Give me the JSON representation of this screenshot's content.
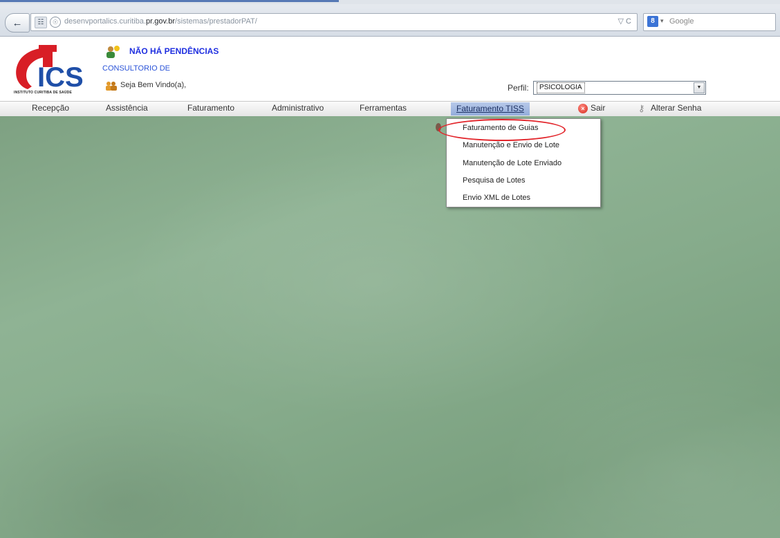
{
  "browser": {
    "url_prefix": "desenvportalics.curitiba.",
    "url_domain": "pr.gov.br",
    "url_suffix": "/sistemas/prestadorPAT/",
    "url_controls": "▽ C",
    "search_engine": "Google",
    "search_caret": "▾"
  },
  "header": {
    "pending": "NÃO HÁ PENDÊNCIAS",
    "consultorio": "CONSULTORIO DE",
    "welcome": "Seja Bem Vindo(a),",
    "perfil_label": "Perfil:",
    "perfil_value": "PSICOLOGIA",
    "logo_text": "ICS",
    "logo_sub": "INSTITUTO CURITIBA DE SAÚDE"
  },
  "menu": {
    "items": [
      {
        "label": "Recepção"
      },
      {
        "label": "Assistência"
      },
      {
        "label": "Faturamento"
      },
      {
        "label": "Administrativo"
      },
      {
        "label": "Ferramentas"
      },
      {
        "label": "Faturamento TISS"
      },
      {
        "label": "Sair"
      },
      {
        "label": "Alterar Senha"
      }
    ]
  },
  "dropdown": {
    "items": [
      {
        "label": "Faturamento de Guias"
      },
      {
        "label": "Manutenção e Envio de Lote"
      },
      {
        "label": "Manutenção de Lote Enviado"
      },
      {
        "label": "Pesquisa de Lotes"
      },
      {
        "label": "Envio XML de Lotes"
      }
    ]
  },
  "colors": {
    "highlight": "#e2252b",
    "pending_text": "#1f2fe0",
    "logo_red": "#d81e26",
    "logo_blue": "#1f4fa8"
  },
  "icons": {
    "back": "back-arrow-icon",
    "sair": "exit-icon",
    "alterar_senha": "key-icon",
    "pending": "user-alert-icon",
    "welcome": "users-icon"
  }
}
